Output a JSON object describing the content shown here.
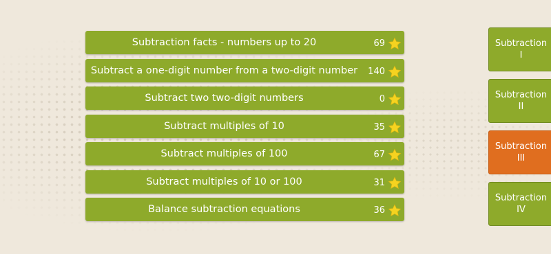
{
  "skills": [
    {
      "label": "Subtraction facts - numbers up to 20",
      "count": "69"
    },
    {
      "label": "Subtract a one-digit number from a two-digit number",
      "count": "140"
    },
    {
      "label": "Subtract two two-digit numbers",
      "count": "0"
    },
    {
      "label": "Subtract multiples of 10",
      "count": "35"
    },
    {
      "label": "Subtract multiples of 100",
      "count": "67"
    },
    {
      "label": "Subtract multiples of 10 or 100",
      "count": "31"
    },
    {
      "label": "Balance subtraction equations",
      "count": "36"
    }
  ],
  "levels": [
    {
      "line1": "Subtraction",
      "line2": "I",
      "active": false
    },
    {
      "line1": "Subtraction",
      "line2": "II",
      "active": false
    },
    {
      "line1": "Subtraction",
      "line2": "III",
      "active": true
    },
    {
      "line1": "Subtraction",
      "line2": "IV",
      "active": false
    }
  ],
  "colors": {
    "row_green": "#8eaa2b",
    "active_orange": "#e06e1f",
    "star_yellow": "#f5d320",
    "background": "#efe8dc"
  },
  "icons": {
    "star": "star-icon"
  }
}
